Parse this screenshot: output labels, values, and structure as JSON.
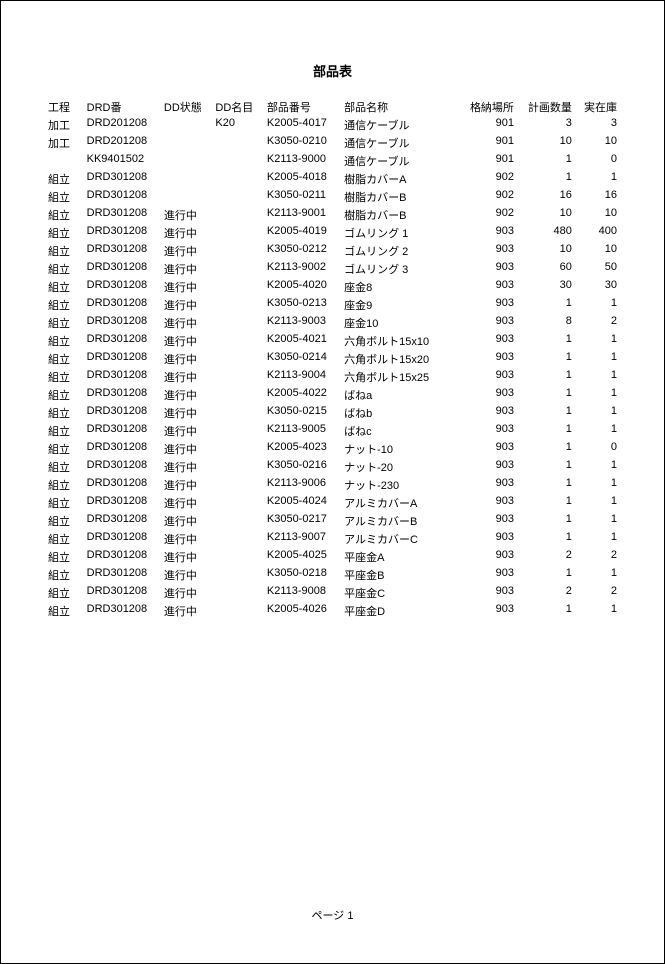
{
  "title": "部品表",
  "footer": "ページ 1",
  "columns": [
    "工程",
    "DRD番",
    "DD状態",
    "DD名目",
    "部品番号",
    "部品名称",
    "格納場所",
    "計画数量",
    "実在庫"
  ],
  "rows": [
    {
      "proc": "加工",
      "drd": "DRD201208",
      "status": "",
      "ddname": "K20",
      "partno": "K2005-4017",
      "partnm": "通信ケーブル",
      "loc": "901",
      "plan": "3",
      "stock": "3"
    },
    {
      "proc": "加工",
      "drd": "DRD201208",
      "status": "",
      "ddname": "",
      "partno": "K3050-0210",
      "partnm": "通信ケーブル",
      "loc": "901",
      "plan": "10",
      "stock": "10"
    },
    {
      "proc": "",
      "drd": "KK9401502",
      "status": "",
      "ddname": "",
      "partno": "K2113-9000",
      "partnm": "通信ケーブル",
      "loc": "901",
      "plan": "1",
      "stock": "0"
    },
    {
      "proc": "組立",
      "drd": "DRD301208",
      "status": "",
      "ddname": "",
      "partno": "K2005-4018",
      "partnm": "樹脂カバーA",
      "loc": "902",
      "plan": "1",
      "stock": "1"
    },
    {
      "proc": "組立",
      "drd": "DRD301208",
      "status": "",
      "ddname": "",
      "partno": "K3050-0211",
      "partnm": "樹脂カバーB",
      "loc": "902",
      "plan": "16",
      "stock": "16"
    },
    {
      "proc": "組立",
      "drd": "DRD301208",
      "status": "進行中",
      "ddname": "",
      "partno": "K2113-9001",
      "partnm": "樹脂カバーB",
      "loc": "902",
      "plan": "10",
      "stock": "10"
    },
    {
      "proc": "組立",
      "drd": "DRD301208",
      "status": "進行中",
      "ddname": "",
      "partno": "K2005-4019",
      "partnm": "ゴムリング 1",
      "loc": "903",
      "plan": "480",
      "stock": "400"
    },
    {
      "proc": "組立",
      "drd": "DRD301208",
      "status": "進行中",
      "ddname": "",
      "partno": "K3050-0212",
      "partnm": "ゴムリング 2",
      "loc": "903",
      "plan": "10",
      "stock": "10"
    },
    {
      "proc": "組立",
      "drd": "DRD301208",
      "status": "進行中",
      "ddname": "",
      "partno": "K2113-9002",
      "partnm": "ゴムリング 3",
      "loc": "903",
      "plan": "60",
      "stock": "50"
    },
    {
      "proc": "組立",
      "drd": "DRD301208",
      "status": "進行中",
      "ddname": "",
      "partno": "K2005-4020",
      "partnm": "座金8",
      "loc": "903",
      "plan": "30",
      "stock": "30"
    },
    {
      "proc": "組立",
      "drd": "DRD301208",
      "status": "進行中",
      "ddname": "",
      "partno": "K3050-0213",
      "partnm": "座金9",
      "loc": "903",
      "plan": "1",
      "stock": "1"
    },
    {
      "proc": "組立",
      "drd": "DRD301208",
      "status": "進行中",
      "ddname": "",
      "partno": "K2113-9003",
      "partnm": "座金10",
      "loc": "903",
      "plan": "8",
      "stock": "2"
    },
    {
      "proc": "組立",
      "drd": "DRD301208",
      "status": "進行中",
      "ddname": "",
      "partno": "K2005-4021",
      "partnm": "六角ボルト15x10",
      "loc": "903",
      "plan": "1",
      "stock": "1"
    },
    {
      "proc": "組立",
      "drd": "DRD301208",
      "status": "進行中",
      "ddname": "",
      "partno": "K3050-0214",
      "partnm": "六角ボルト15x20",
      "loc": "903",
      "plan": "1",
      "stock": "1"
    },
    {
      "proc": "組立",
      "drd": "DRD301208",
      "status": "進行中",
      "ddname": "",
      "partno": "K2113-9004",
      "partnm": "六角ボルト15x25",
      "loc": "903",
      "plan": "1",
      "stock": "1"
    },
    {
      "proc": "組立",
      "drd": "DRD301208",
      "status": "進行中",
      "ddname": "",
      "partno": "K2005-4022",
      "partnm": "ばねa",
      "loc": "903",
      "plan": "1",
      "stock": "1"
    },
    {
      "proc": "組立",
      "drd": "DRD301208",
      "status": "進行中",
      "ddname": "",
      "partno": "K3050-0215",
      "partnm": "ばねb",
      "loc": "903",
      "plan": "1",
      "stock": "1"
    },
    {
      "proc": "組立",
      "drd": "DRD301208",
      "status": "進行中",
      "ddname": "",
      "partno": "K2113-9005",
      "partnm": "ばねc",
      "loc": "903",
      "plan": "1",
      "stock": "1"
    },
    {
      "proc": "組立",
      "drd": "DRD301208",
      "status": "進行中",
      "ddname": "",
      "partno": "K2005-4023",
      "partnm": "ナット-10",
      "loc": "903",
      "plan": "1",
      "stock": "0"
    },
    {
      "proc": "組立",
      "drd": "DRD301208",
      "status": "進行中",
      "ddname": "",
      "partno": "K3050-0216",
      "partnm": "ナット-20",
      "loc": "903",
      "plan": "1",
      "stock": "1"
    },
    {
      "proc": "組立",
      "drd": "DRD301208",
      "status": "進行中",
      "ddname": "",
      "partno": "K2113-9006",
      "partnm": "ナット-230",
      "loc": "903",
      "plan": "1",
      "stock": "1"
    },
    {
      "proc": "組立",
      "drd": "DRD301208",
      "status": "進行中",
      "ddname": "",
      "partno": "K2005-4024",
      "partnm": "アルミカバーA",
      "loc": "903",
      "plan": "1",
      "stock": "1"
    },
    {
      "proc": "組立",
      "drd": "DRD301208",
      "status": "進行中",
      "ddname": "",
      "partno": "K3050-0217",
      "partnm": "アルミカバーB",
      "loc": "903",
      "plan": "1",
      "stock": "1"
    },
    {
      "proc": "組立",
      "drd": "DRD301208",
      "status": "進行中",
      "ddname": "",
      "partno": "K2113-9007",
      "partnm": "アルミカバーC",
      "loc": "903",
      "plan": "1",
      "stock": "1"
    },
    {
      "proc": "組立",
      "drd": "DRD301208",
      "status": "進行中",
      "ddname": "",
      "partno": "K2005-4025",
      "partnm": "平座金A",
      "loc": "903",
      "plan": "2",
      "stock": "2"
    },
    {
      "proc": "組立",
      "drd": "DRD301208",
      "status": "進行中",
      "ddname": "",
      "partno": "K3050-0218",
      "partnm": "平座金B",
      "loc": "903",
      "plan": "1",
      "stock": "1"
    },
    {
      "proc": "組立",
      "drd": "DRD301208",
      "status": "進行中",
      "ddname": "",
      "partno": "K2113-9008",
      "partnm": "平座金C",
      "loc": "903",
      "plan": "2",
      "stock": "2"
    },
    {
      "proc": "組立",
      "drd": "DRD301208",
      "status": "進行中",
      "ddname": "",
      "partno": "K2005-4026",
      "partnm": "平座金D",
      "loc": "903",
      "plan": "1",
      "stock": "1"
    }
  ]
}
